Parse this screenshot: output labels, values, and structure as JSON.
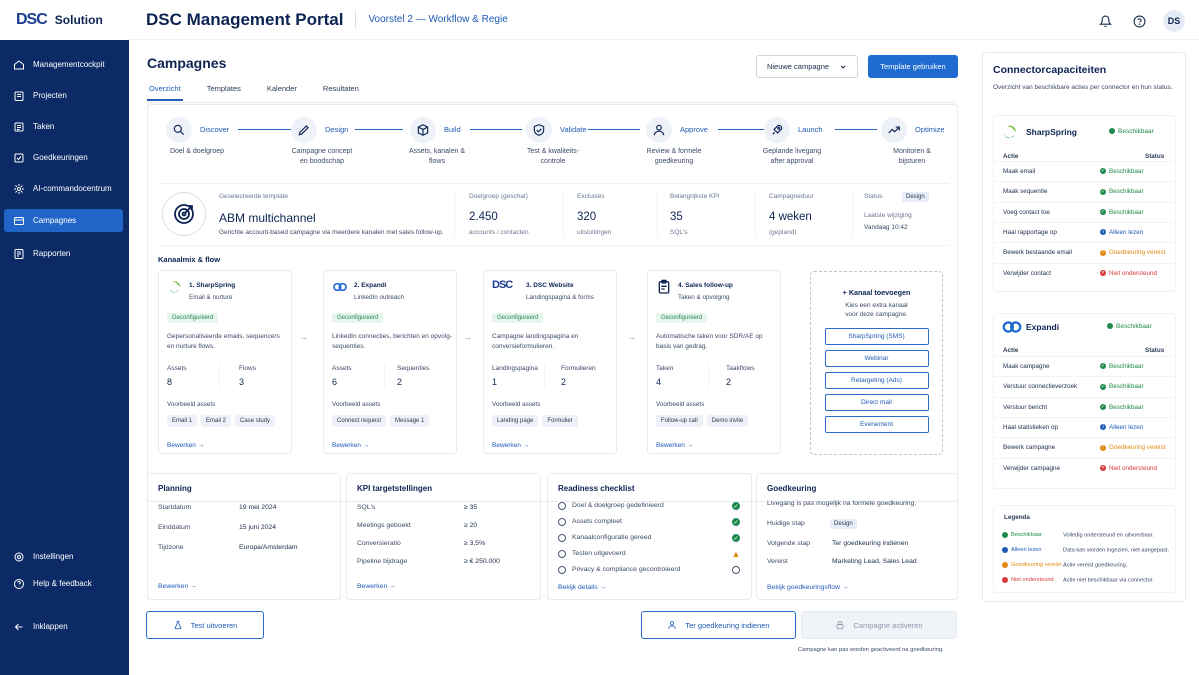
{
  "brand": {
    "logo_text": "DSC",
    "name": "Solution"
  },
  "header": {
    "title": "DSC Management Portal",
    "subtitle": "Voorstel 2 — Workflow & Regie",
    "avatar": "DS"
  },
  "sidebar": {
    "items": [
      {
        "label": "Managementcockpit",
        "icon": "home-icon"
      },
      {
        "label": "Projecten",
        "icon": "folder-icon"
      },
      {
        "label": "Taken",
        "icon": "tasks-icon"
      },
      {
        "label": "Goedkeuringen",
        "icon": "check-square-icon"
      },
      {
        "label": "AI-commandocentrum",
        "icon": "ai-icon"
      },
      {
        "label": "Campagnes",
        "icon": "campaign-icon",
        "active": true
      },
      {
        "label": "Rapporten",
        "icon": "report-icon"
      }
    ],
    "bottom": [
      {
        "label": "Instellingen"
      },
      {
        "label": "Help & feedback"
      },
      {
        "label": "Inklappen"
      }
    ]
  },
  "page": {
    "title": "Campagnes",
    "new_campaign": "Nieuwe campagne",
    "use_template": "Template gebruiken",
    "tabs": [
      "Overzicht",
      "Templates",
      "Kalender",
      "Resultaten"
    ]
  },
  "workflow": [
    {
      "label": "Discover",
      "desc": "Doel & doelgroep"
    },
    {
      "label": "Design",
      "desc": "Campagne concept\nen boodschap"
    },
    {
      "label": "Build",
      "desc": "Assets, kanalen &\nflows"
    },
    {
      "label": "Validate",
      "desc": "Test & kwaliteits-\ncontrole"
    },
    {
      "label": "Approve",
      "desc": "Review & formele\ngoedkeuring"
    },
    {
      "label": "Launch",
      "desc": "Geplande livegang\nafter approval"
    },
    {
      "label": "Optimize",
      "desc": "Monitoren &\nbijsturen"
    }
  ],
  "summary": {
    "template_label": "Geselecteerde template",
    "template_name": "ABM multichannel",
    "template_desc": "Gerichte account-based campagne via meerdere kanalen met sales follow-up.",
    "metrics": [
      {
        "label": "Doelgroep (geschat)",
        "value": "2.450",
        "sub": "accounts / contacten"
      },
      {
        "label": "Exclusies",
        "value": "320",
        "sub": "uitsluitingen"
      },
      {
        "label": "Belangrijkste KPI",
        "value": "35",
        "sub": "SQL's"
      },
      {
        "label": "Campagneduur",
        "value": "4 weken",
        "sub": "(gepland)"
      }
    ],
    "status_label": "Status",
    "status": "Design",
    "last_change_label": "Laatste wijziging",
    "last_change": "Vandaag 10:42"
  },
  "channels": {
    "title": "Kanaalmix & flow",
    "items": [
      {
        "name": "1. SharpSpring",
        "type": "Email & nurture",
        "badge": "Geconfigureerd",
        "desc": "Gepersonaliseerde emails, sequencers en nurture flows.",
        "m1l": "Assets",
        "m1v": "8",
        "m2l": "Flows",
        "m2v": "3",
        "assets_label": "Voorbeeld assets",
        "chips": [
          "Email 1",
          "Email 2",
          "Case study"
        ],
        "edit": "Bewerken →"
      },
      {
        "name": "2. Expandi",
        "type": "LinkedIn outreach",
        "badge": "Geconfigureerd",
        "desc": "LinkedIn connecties, berichten en opvolg-sequenties.",
        "m1l": "Assets",
        "m1v": "6",
        "m2l": "Sequenties",
        "m2v": "2",
        "assets_label": "Voorbeeld assets",
        "chips": [
          "Connect request",
          "Message 1"
        ],
        "edit": "Bewerken →"
      },
      {
        "name": "3. DSC Website",
        "type": "Landingspagina & forms",
        "badge": "Geconfigureerd",
        "desc": "Campagne landingspagina en conversieformulieren.",
        "m1l": "Landingspagina",
        "m1v": "1",
        "m2l": "Formulieren",
        "m2v": "2",
        "assets_label": "Voorbeeld assets",
        "chips": [
          "Landing page",
          "Formulier"
        ],
        "edit": "Bewerken →"
      },
      {
        "name": "4. Sales follow-up",
        "type": "Taken & opvolging",
        "badge": "Geconfigureerd",
        "desc": "Automatische taken voor SDR/AE op basis van gedrag.",
        "m1l": "Taken",
        "m1v": "4",
        "m2l": "Taakflows",
        "m2v": "2",
        "assets_label": "Voorbeeld assets",
        "chips": [
          "Follow-up call",
          "Demo invite"
        ],
        "edit": "Bewerken →"
      }
    ],
    "add": {
      "title": "+ Kanaal toevoegen",
      "desc": "Kies een extra kanaal\nvoor deze campagne.",
      "options": [
        "SharpSpring (SMS)",
        "Webinar",
        "Retargeting (Ads)",
        "Direct mail",
        "Evenement"
      ]
    }
  },
  "planning": {
    "title": "Planning",
    "rows": [
      {
        "l": "Startdatum",
        "v": "19 mei 2024"
      },
      {
        "l": "Einddatum",
        "v": "15 juni 2024"
      },
      {
        "l": "Tijdzone",
        "v": "Europa/Amsterdam"
      }
    ],
    "edit": "Bewerken →"
  },
  "kpi": {
    "title": "KPI targetstellingen",
    "rows": [
      {
        "l": "SQL's",
        "v": "≥ 35"
      },
      {
        "l": "Meetings geboekt",
        "v": "≥ 20"
      },
      {
        "l": "Conversieratio",
        "v": "≥ 3,5%"
      },
      {
        "l": "Pipeline bijdrage",
        "v": "≥ € 250.000"
      }
    ],
    "edit": "Bewerken →"
  },
  "readiness": {
    "title": "Readiness checklist",
    "rows": [
      {
        "l": "Doel & doelgroep gedefinieerd",
        "s": "ok"
      },
      {
        "l": "Assets compleet",
        "s": "ok"
      },
      {
        "l": "Kanaalconfiguratie gereed",
        "s": "ok"
      },
      {
        "l": "Testen uitgevoerd",
        "s": "warn"
      },
      {
        "l": "Privacy & compliance gecontroleerd",
        "s": "open"
      }
    ],
    "link": "Bekijk details →"
  },
  "approval": {
    "title": "Goedkeuring",
    "desc": "Livegang is pas mogelijk na formele goedkeuring.",
    "rows": [
      {
        "l": "Huidige stap",
        "v": "Design"
      },
      {
        "l": "Volgende stap",
        "v": "Ter goedkeuring indienen"
      },
      {
        "l": "Vereist",
        "v": "Marketing Lead, Sales Lead"
      }
    ],
    "link": "Bekijk goedkeuringsflow →"
  },
  "actions": {
    "test": "Test uitvoeren",
    "submit": "Ter goedkeuring indienen",
    "activate": "Campagne activeren",
    "note": "Campagne kan pas worden geactiveerd na goedkeuring."
  },
  "connectors": {
    "title": "Connectorcapaciteiten",
    "desc": "Overzicht van beschikbare acties per connector en hun status.",
    "col_action": "Actie",
    "col_status": "Status",
    "items": [
      {
        "name": "SharpSpring",
        "status": "Beschikbaar",
        "actions": [
          {
            "a": "Maak email",
            "s": "Beschikbaar",
            "t": "ok"
          },
          {
            "a": "Maak sequentie",
            "s": "Beschikbaar",
            "t": "ok"
          },
          {
            "a": "Voeg contact toe",
            "s": "Beschikbaar",
            "t": "ok"
          },
          {
            "a": "Haal rapportage op",
            "s": "Alleen lezen",
            "t": "info"
          },
          {
            "a": "Bewerk bestaande email",
            "s": "Goedkeuring vereist",
            "t": "warn"
          },
          {
            "a": "Verwijder contact",
            "s": "Niet ondersteund",
            "t": "err"
          }
        ]
      },
      {
        "name": "Expandi",
        "status": "Beschikbaar",
        "actions": [
          {
            "a": "Maak campagne",
            "s": "Beschikbaar",
            "t": "ok"
          },
          {
            "a": "Verstuur connectieverzoek",
            "s": "Beschikbaar",
            "t": "ok"
          },
          {
            "a": "Verstuur bericht",
            "s": "Beschikbaar",
            "t": "ok"
          },
          {
            "a": "Haal statistieken op",
            "s": "Alleen lezen",
            "t": "info"
          },
          {
            "a": "Bewerk campagne",
            "s": "Goedkeuring vereist",
            "t": "warn"
          },
          {
            "a": "Verwijder campagne",
            "s": "Niet ondersteund",
            "t": "err"
          }
        ]
      }
    ],
    "legend": {
      "title": "Legenda",
      "rows": [
        {
          "s": "Beschikbaar",
          "d": "Volledig ondersteund en uitvoerbaar.",
          "t": "ok"
        },
        {
          "s": "Alleen lezen",
          "d": "Data kan worden ingezien, niet aangepast.",
          "t": "info"
        },
        {
          "s": "Goedkeuring vereist",
          "d": "Actie vereist goedkeuring.",
          "t": "warn"
        },
        {
          "s": "Niet ondersteund",
          "d": "Actie niet beschikbaar via connector.",
          "t": "err"
        }
      ]
    }
  },
  "colors": {
    "navy": "#0c2b66",
    "accent": "#1f6bd0",
    "ok": "#1f8a4c",
    "info": "#1f5bb5",
    "warn": "#e08a10",
    "err": "#d63a3a"
  }
}
